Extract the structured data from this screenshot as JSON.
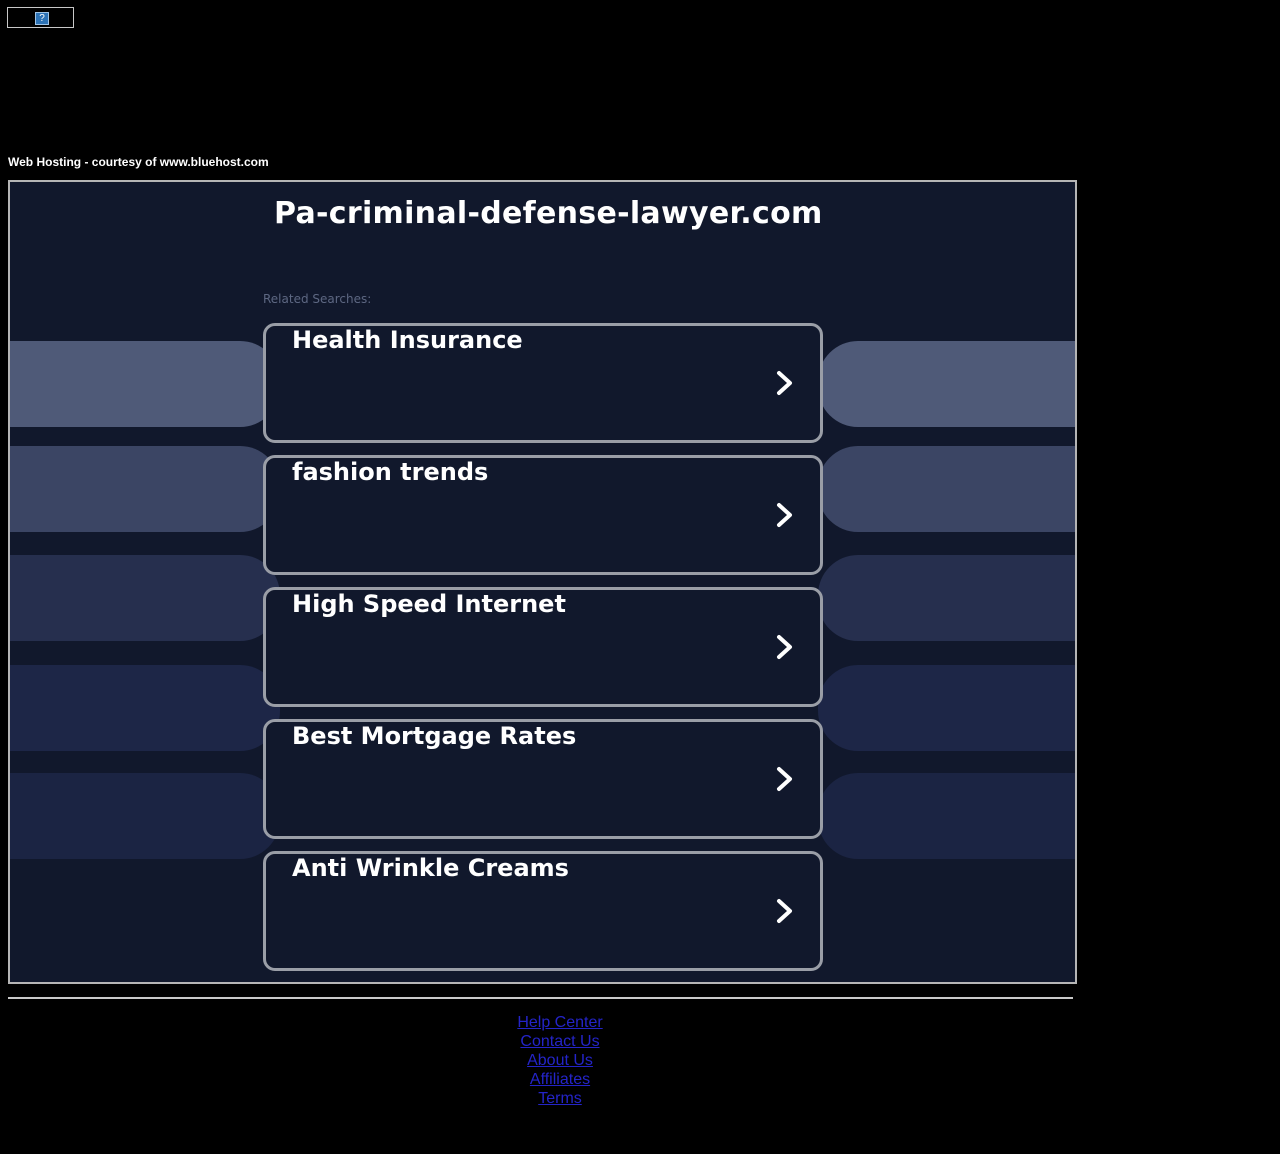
{
  "header": {
    "broken_image_glyph": "?",
    "hosting_text": "Web Hosting - courtesy of www.bluehost.com"
  },
  "main": {
    "domain_title": "Pa-criminal-defense-lawyer.com",
    "related_label": "Related Searches:",
    "items": [
      {
        "label": "Health Insurance"
      },
      {
        "label": "fashion trends"
      },
      {
        "label": "High Speed Internet"
      },
      {
        "label": "Best Mortgage Rates"
      },
      {
        "label": "Anti Wrinkle Creams"
      }
    ],
    "bar_colors": [
      "#4f5a78",
      "#3b4564",
      "#262f4e",
      "#1d2647",
      "#1b2443"
    ]
  },
  "footer": {
    "links": [
      {
        "label": "Help Center"
      },
      {
        "label": "Contact Us"
      },
      {
        "label": "About Us"
      },
      {
        "label": "Affiliates"
      },
      {
        "label": "Terms"
      }
    ]
  }
}
